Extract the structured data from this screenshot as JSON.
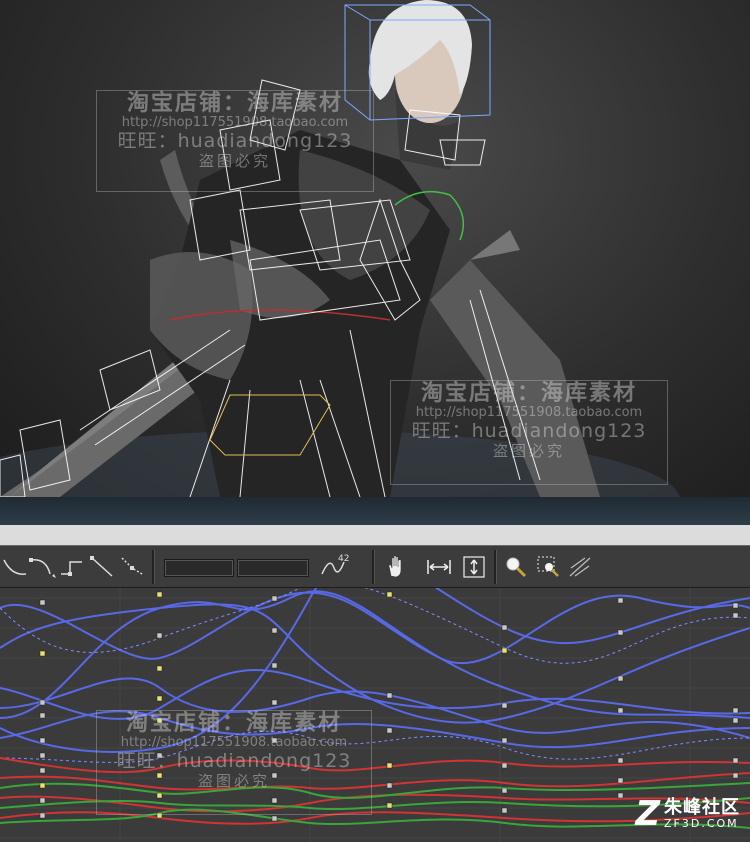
{
  "watermark": {
    "line1": "淘宝店铺：海库素材",
    "line2": "http://shop117551908.taobao.com",
    "line3": "旺旺：huadiandong123",
    "line4": "盗图必究"
  },
  "toolbar": {
    "value_label": "42",
    "tools": [
      "curve-smooth-icon",
      "curve-bezier-icon",
      "curve-step-icon",
      "curve-linear-icon",
      "curve-fast-icon",
      "curve-ease-icon",
      "hand-pan-icon",
      "zoom-horizontal-icon",
      "zoom-vertical-icon",
      "zoom-icon",
      "zoom-region-icon",
      "normalize-icon"
    ]
  },
  "logo": {
    "mark": "Z",
    "name": "朱峰社区",
    "domain": "ZF3D.COM"
  },
  "colors": {
    "viewport_bg": "#2e2e2e",
    "graph_bg": "#3b3b3b",
    "curve_blue": "#5a6cf0",
    "curve_red": "#d03434",
    "curve_green": "#3aa53a",
    "key_gray": "#c8c8c8",
    "key_yellow": "#e8e070"
  }
}
